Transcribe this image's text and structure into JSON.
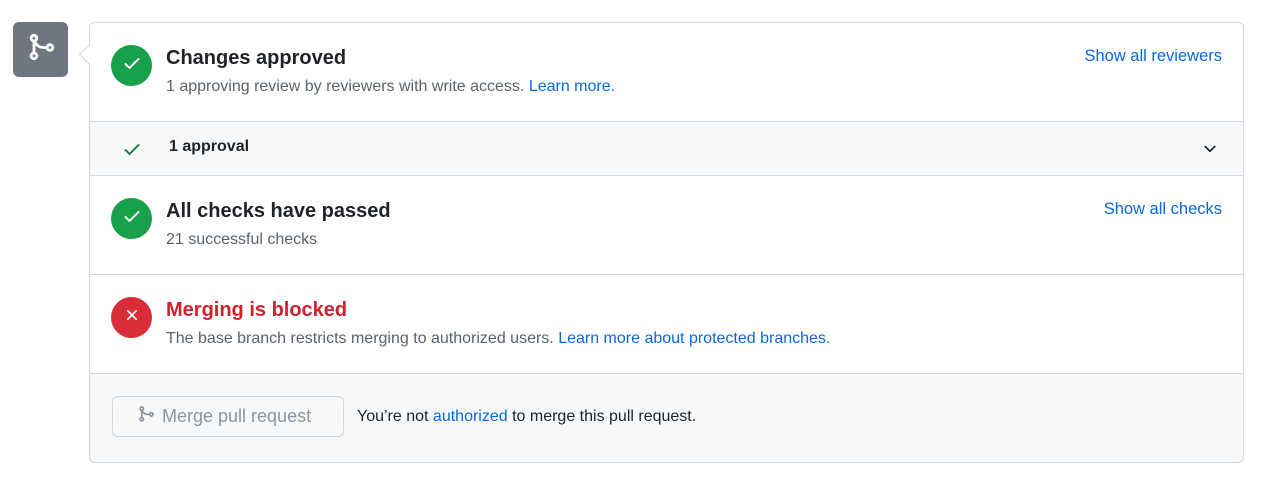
{
  "icons": {
    "badge": "git-merge-icon",
    "approved": "check-icon",
    "checks": "check-icon",
    "blocked": "x-icon",
    "approval_row": "check-icon",
    "expand": "chevron-down-icon",
    "merge_button": "git-merge-icon"
  },
  "colors": {
    "success": "#18a04a",
    "danger": "#d92d3a",
    "link": "#0969da",
    "badge": "#6e7781"
  },
  "review": {
    "title": "Changes approved",
    "subtitle_prefix": "1 approving review by reviewers with write access. ",
    "subtitle_link": "Learn more.",
    "action_link": "Show all reviewers"
  },
  "approvals": {
    "label": "1 approval"
  },
  "checks": {
    "title": "All checks have passed",
    "subtitle": "21 successful checks",
    "action_link": "Show all checks"
  },
  "blocked": {
    "title": "Merging is blocked",
    "subtitle_prefix": "The base branch restricts merging to authorized users. ",
    "subtitle_link": "Learn more about protected branches."
  },
  "merge": {
    "button_label": "Merge pull request",
    "note_prefix": "You’re not ",
    "note_link": "authorized",
    "note_suffix": " to merge this pull request."
  }
}
